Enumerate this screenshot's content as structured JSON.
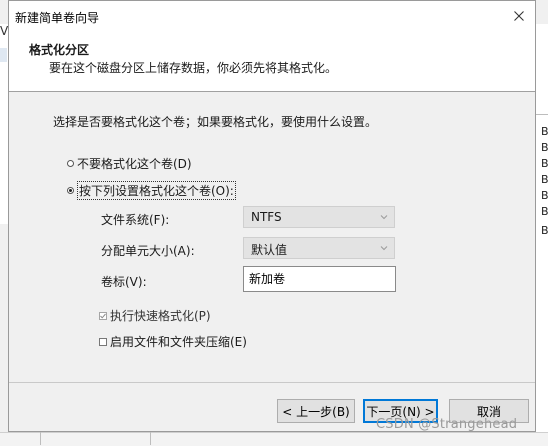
{
  "background": {
    "left_letter": "V",
    "right_letters": [
      "B",
      "B",
      "B",
      "B",
      "B",
      "B",
      "B"
    ]
  },
  "dialog": {
    "title": "新建简单卷向导",
    "header_title": "格式化分区",
    "header_subtitle": "要在这个磁盘分区上储存数据，你必须先将其格式化。",
    "instruction": "选择是否要格式化这个卷；如果要格式化，要使用什么设置。",
    "radio_no_format": "不要格式化这个卷(D)",
    "radio_format": "按下列设置格式化这个卷(O):",
    "filesystem_label": "文件系统(F):",
    "filesystem_value": "NTFS",
    "allocation_label": "分配单元大小(A):",
    "allocation_value": "默认值",
    "volume_label_label": "卷标(V):",
    "volume_label_value": "新加卷",
    "quick_format_label": "执行快速格式化(P)",
    "compression_label": "启用文件和文件夹压缩(E)",
    "quick_format_checked": true,
    "compression_checked": false,
    "selected_radio": "format",
    "back_button": "< 上一步(B)",
    "next_button": "下一页(N) >",
    "cancel_button": "取消"
  },
  "watermark": "CSDN @Strangehead",
  "colors": {
    "accent": "#0078d7",
    "window_bg": "#f0f0f0",
    "header_bg": "#ffffff"
  }
}
